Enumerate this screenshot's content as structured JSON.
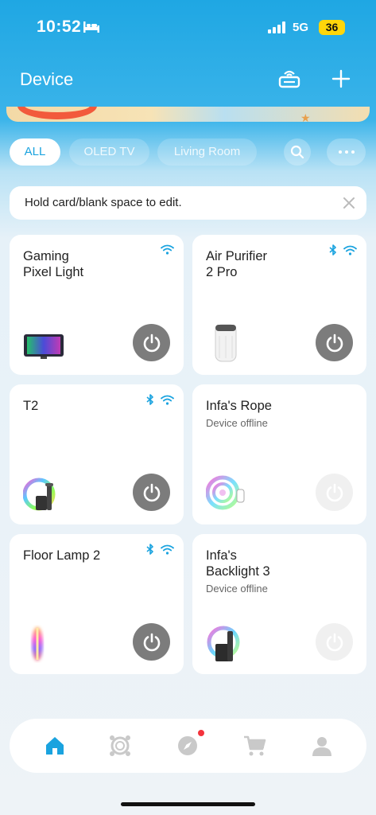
{
  "status_bar": {
    "time": "10:52",
    "network": "5G",
    "battery": "36"
  },
  "header": {
    "title": "Device"
  },
  "filters": {
    "tabs": [
      {
        "label": "ALL"
      },
      {
        "label": "OLED TV"
      },
      {
        "label": "Living Room"
      }
    ]
  },
  "hint": {
    "text": "Hold card/blank space to edit."
  },
  "devices": [
    {
      "name": "Gaming\nPixel Light",
      "status": "",
      "power": "on"
    },
    {
      "name": "Air Purifier\n2 Pro",
      "status": "",
      "power": "on"
    },
    {
      "name": "T2",
      "status": "",
      "power": "on"
    },
    {
      "name": "Infa's Rope",
      "status": "Device offline",
      "power": "offline"
    },
    {
      "name": "Floor Lamp 2",
      "status": "",
      "power": "on"
    },
    {
      "name": "Infa's\nBacklight 3",
      "status": "Device offline",
      "power": "offline"
    }
  ],
  "colors": {
    "accent": "#1aa3df",
    "header_bg": "#1fa7e3",
    "power_on": "#7c7c7c",
    "power_off": "#f0f0f0",
    "badge": "#f4333c"
  },
  "nav": [
    {
      "icon": "home-icon"
    },
    {
      "icon": "scenes-icon"
    },
    {
      "icon": "discover-icon"
    },
    {
      "icon": "cart-icon"
    },
    {
      "icon": "profile-icon"
    }
  ]
}
